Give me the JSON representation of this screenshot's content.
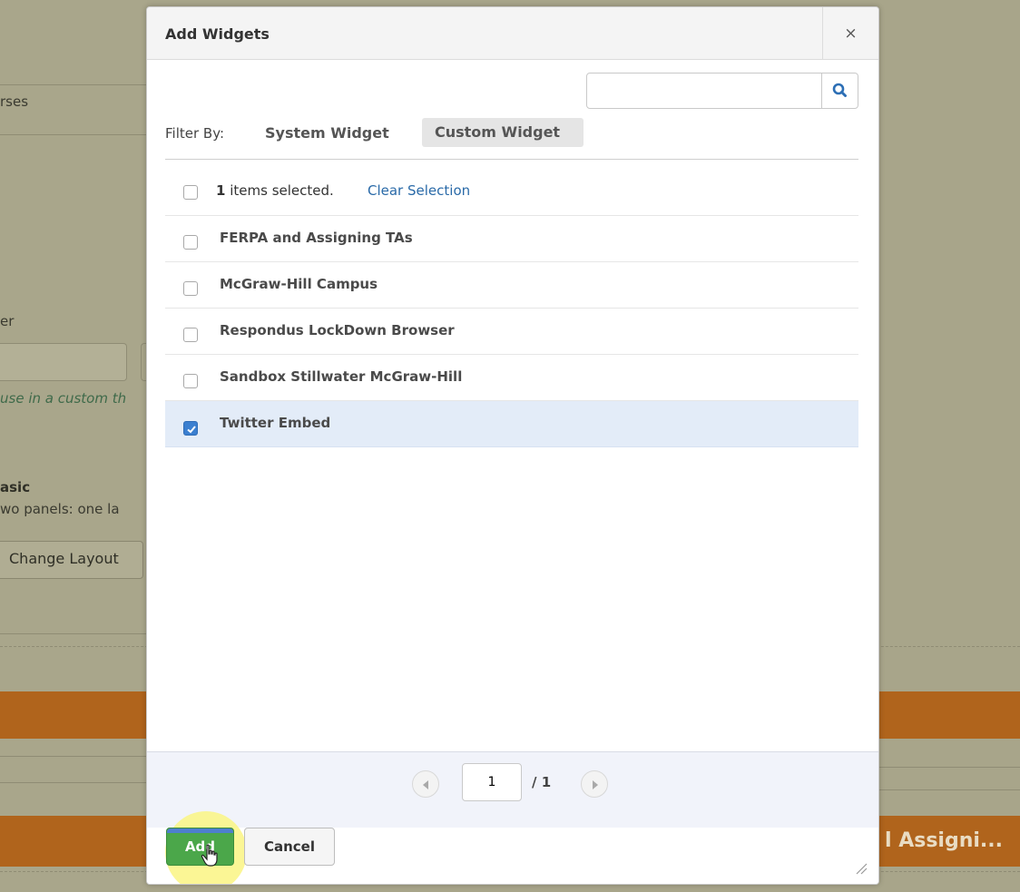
{
  "background": {
    "fragments": [
      "rses",
      "er",
      "use in a custom th",
      "asic",
      "wo panels: one la"
    ],
    "change_layout_label": "Change Layout",
    "right_heading": "l Assigni..."
  },
  "dialog": {
    "title": "Add Widgets",
    "close_glyph": "×",
    "search": {
      "value": "",
      "placeholder": "",
      "icon": "search-icon"
    },
    "filter": {
      "label": "Filter By:",
      "options": [
        "System Widget",
        "Custom Widget"
      ],
      "active": "Custom Widget"
    },
    "selection": {
      "count": "1",
      "text": "items selected.",
      "clear_label": "Clear Selection"
    },
    "items": [
      {
        "label": "FERPA and Assigning TAs",
        "checked": false
      },
      {
        "label": "McGraw-Hill Campus",
        "checked": false
      },
      {
        "label": "Respondus LockDown Browser",
        "checked": false
      },
      {
        "label": "Sandbox Stillwater McGraw-Hill",
        "checked": false
      },
      {
        "label": "Twitter Embed",
        "checked": true
      }
    ],
    "pager": {
      "page": "1",
      "total": "/ 1"
    },
    "buttons": {
      "add": "Add",
      "cancel": "Cancel"
    }
  },
  "colors": {
    "accent_blue": "#3b7fd0",
    "link": "#2a6aa8",
    "add_green": "#4ba74a",
    "selected_row": "#e3ecf8",
    "overlay_bg": "#a8a58a",
    "banner_orange": "#b0641c"
  }
}
